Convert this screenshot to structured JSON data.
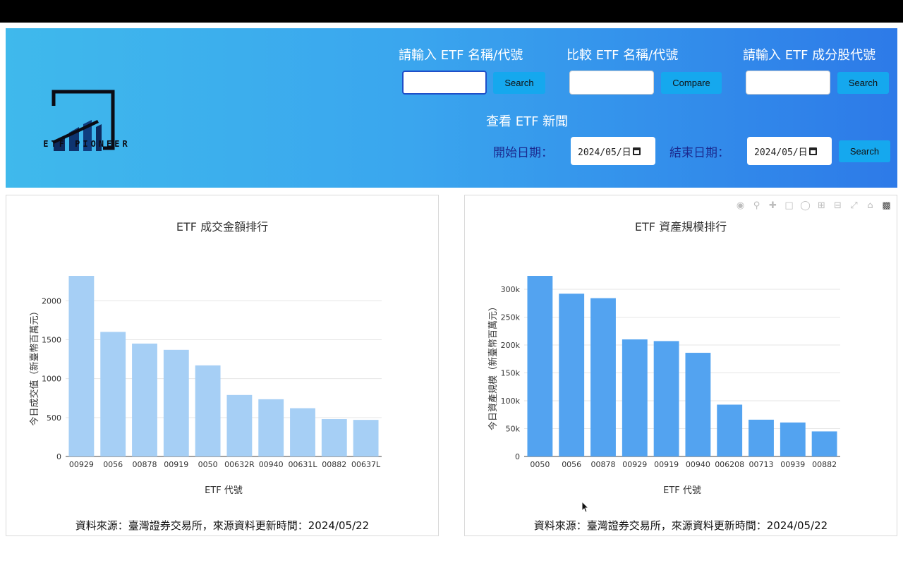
{
  "header": {
    "logo_text": "ETF PIONEER",
    "search_etf_label": "請輸入 ETF 名稱/代號",
    "search_etf_value": "",
    "search_button": "Search",
    "compare_label": "比較 ETF 名稱/代號",
    "compare_value": "",
    "compare_button": "Compare",
    "component_label": "請輸入 ETF 成分股代號",
    "component_value": "",
    "component_button": "Search",
    "news_label": "查看 ETF 新聞",
    "start_label": "開始日期：",
    "start_value": "2024/05/日",
    "end_label": "結束日期：",
    "end_value": "2024/05/日",
    "news_button": "Search"
  },
  "colors": {
    "header_left": "#3fb9ec",
    "header_right": "#2d7ae8",
    "button": "#15a8ee",
    "bar_left": "#a6cff5",
    "bar_right": "#53a3f0"
  },
  "modebar_icons": [
    "camera-icon",
    "zoom-icon",
    "pan-icon",
    "box-select-icon",
    "lasso-icon",
    "zoom-in-icon",
    "zoom-out-icon",
    "autoscale-icon",
    "reset-axes-icon",
    "plotly-logo-icon"
  ],
  "left_panel": {
    "source": "資料來源：臺灣證券交易所，來源資料更新時間：2024/05/22"
  },
  "right_panel": {
    "source": "資料來源：臺灣證券交易所，來源資料更新時間：2024/05/22"
  },
  "chart_data": [
    {
      "type": "bar",
      "title": "ETF 成交金額排行",
      "xlabel": "ETF 代號",
      "ylabel": "今日成交值（新臺幣百萬元）",
      "categories": [
        "00929",
        "0056",
        "00878",
        "00919",
        "0050",
        "00632R",
        "00940",
        "00631L",
        "00882",
        "00637L"
      ],
      "values": [
        2320,
        1600,
        1450,
        1370,
        1170,
        790,
        735,
        620,
        480,
        470
      ],
      "ylim": [
        0,
        2320
      ],
      "yticks": [
        0,
        500,
        1000,
        1500,
        2000
      ],
      "ytick_labels": [
        "0",
        "500",
        "1000",
        "1500",
        "2000"
      ],
      "grid": true,
      "color": "#a6cff5"
    },
    {
      "type": "bar",
      "title": "ETF 資產規模排行",
      "xlabel": "ETF 代號",
      "ylabel": "今日資產規模（新臺幣百萬元）",
      "categories": [
        "0050",
        "0056",
        "00878",
        "00929",
        "00919",
        "00940",
        "006208",
        "00713",
        "00939",
        "00882"
      ],
      "values": [
        324000,
        292000,
        284000,
        210000,
        207000,
        186000,
        93000,
        66000,
        61000,
        45000
      ],
      "ylim": [
        0,
        324000
      ],
      "yticks": [
        0,
        50000,
        100000,
        150000,
        200000,
        250000,
        300000
      ],
      "ytick_labels": [
        "0",
        "50k",
        "100k",
        "150k",
        "200k",
        "250k",
        "300k"
      ],
      "grid": true,
      "color": "#53a3f0"
    }
  ]
}
